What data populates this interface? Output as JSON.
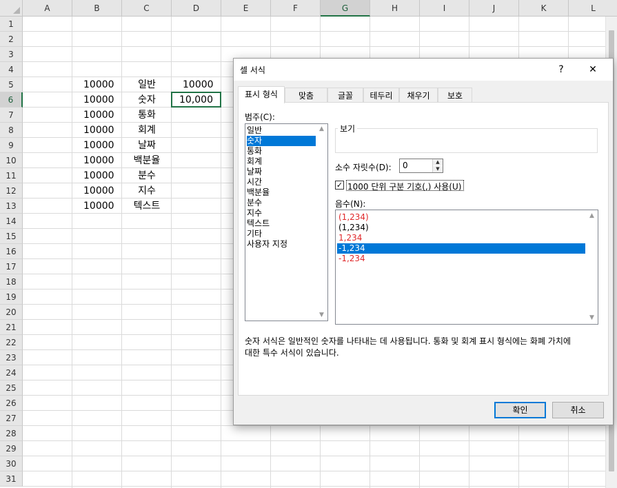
{
  "sheet": {
    "columns": [
      "A",
      "B",
      "C",
      "D",
      "E",
      "F",
      "G",
      "H",
      "I",
      "J",
      "K",
      "L"
    ],
    "rows": [
      "1",
      "2",
      "3",
      "4",
      "5",
      "6",
      "7",
      "8",
      "9",
      "10",
      "11",
      "12",
      "13",
      "14",
      "15",
      "16",
      "17",
      "18",
      "19",
      "20",
      "21",
      "22",
      "23",
      "24",
      "25",
      "26",
      "27",
      "28",
      "29",
      "30",
      "31"
    ],
    "active_column": "G",
    "active_row": "6",
    "col_b_values": [
      "10000",
      "10000",
      "10000",
      "10000",
      "10000",
      "10000",
      "10000",
      "10000",
      "10000"
    ],
    "col_c_values": [
      "일반",
      "숫자",
      "통화",
      "회계",
      "날짜",
      "백분율",
      "분수",
      "지수",
      "텍스트"
    ],
    "d5": "10000",
    "d6": "10,000"
  },
  "dialog": {
    "title": "셀 서식",
    "help_label": "?",
    "close_label": "✕",
    "tabs": [
      "표시 형식",
      "맞춤",
      "글꼴",
      "테두리",
      "채우기",
      "보호"
    ],
    "active_tab": "표시 형식",
    "category_label": "범주(C):",
    "categories": [
      "일반",
      "숫자",
      "통화",
      "회계",
      "날짜",
      "시간",
      "백분율",
      "분수",
      "지수",
      "텍스트",
      "기타",
      "사용자 지정"
    ],
    "selected_category": "숫자",
    "sample_label": "보기",
    "sample_value": "",
    "decimal_label": "소수 자릿수(D):",
    "decimal_value": "0",
    "thousands_label": "1000 단위 구분 기호(,) 사용(U)",
    "thousands_checked": true,
    "negative_label": "음수(N):",
    "negative_options": [
      {
        "text": "(1,234)",
        "red": true
      },
      {
        "text": "(1,234)",
        "red": false
      },
      {
        "text": "1,234",
        "red": true
      },
      {
        "text": "-1,234",
        "red": false,
        "selected": true
      },
      {
        "text": "-1,234",
        "red": true
      }
    ],
    "description_line1": "숫자 서식은 일반적인 숫자를 나타내는 데 사용됩니다. 통화 및 회계 표시 형식에는 화폐 가치에",
    "description_line2": "대한 특수 서식이 있습니다.",
    "ok_label": "확인",
    "cancel_label": "취소"
  },
  "colors": {
    "accent_green": "#217346",
    "selection_blue": "#0078d7",
    "negative_red": "#e0282a"
  }
}
